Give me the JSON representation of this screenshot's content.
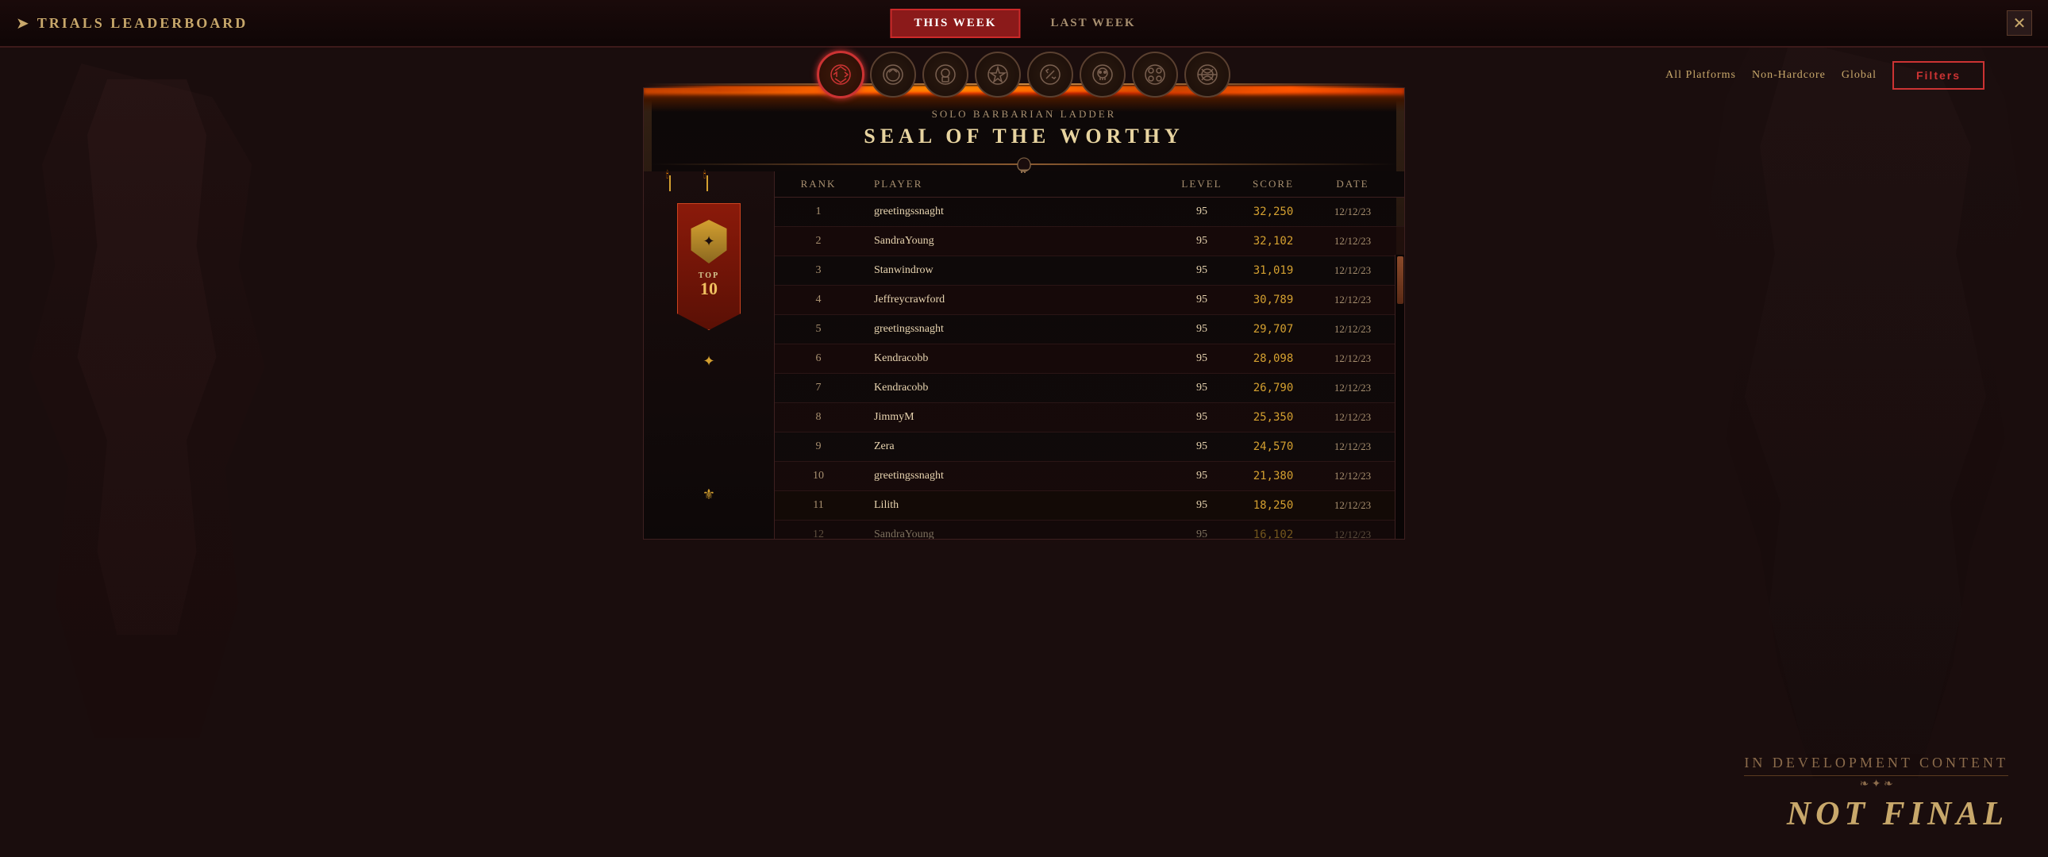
{
  "header": {
    "title": "TRIALS LEADERBOARD",
    "tabs": [
      {
        "label": "THIS WEEK",
        "active": true
      },
      {
        "label": "LAST WEEK",
        "active": false
      }
    ],
    "close_icon": "✕"
  },
  "class_icons": [
    {
      "name": "Barbarian",
      "symbol": "🔱",
      "active": true
    },
    {
      "name": "Druid",
      "symbol": "☽"
    },
    {
      "name": "Necromancer",
      "symbol": "💀"
    },
    {
      "name": "Sorcerer",
      "symbol": "⚡"
    },
    {
      "name": "Rogue",
      "symbol": "🗡"
    },
    {
      "name": "Skull",
      "symbol": "☠"
    },
    {
      "name": "Multi",
      "symbol": "❋"
    },
    {
      "name": "All",
      "symbol": "⊕"
    }
  ],
  "filter_controls": {
    "options": [
      "All Platforms",
      "Non-Hardcore",
      "Global"
    ],
    "filter_button": "Filters"
  },
  "ladder": {
    "subtitle": "SOLO BARBARIAN LADDER",
    "title": "SEAL OF THE WORTHY",
    "banner_top": "TOP",
    "banner_number": "10"
  },
  "table": {
    "columns": [
      {
        "label": "Rank"
      },
      {
        "label": "Player"
      },
      {
        "label": "Level"
      },
      {
        "label": "Score"
      },
      {
        "label": "Date"
      }
    ],
    "rows": [
      {
        "rank": "1",
        "player": "greetingssnaght",
        "level": "95",
        "score": "32,250",
        "date": "12/12/23"
      },
      {
        "rank": "2",
        "player": "SandraYoung",
        "level": "95",
        "score": "32,102",
        "date": "12/12/23"
      },
      {
        "rank": "3",
        "player": "Stanwindrow",
        "level": "95",
        "score": "31,019",
        "date": "12/12/23"
      },
      {
        "rank": "4",
        "player": "Jeffreycrawford",
        "level": "95",
        "score": "30,789",
        "date": "12/12/23"
      },
      {
        "rank": "5",
        "player": "greetingssnaght",
        "level": "95",
        "score": "29,707",
        "date": "12/12/23"
      },
      {
        "rank": "6",
        "player": "Kendracobb",
        "level": "95",
        "score": "28,098",
        "date": "12/12/23"
      },
      {
        "rank": "7",
        "player": "Kendracobb",
        "level": "95",
        "score": "26,790",
        "date": "12/12/23"
      },
      {
        "rank": "8",
        "player": "JimmyM",
        "level": "95",
        "score": "25,350",
        "date": "12/12/23"
      },
      {
        "rank": "9",
        "player": "Zera",
        "level": "95",
        "score": "24,570",
        "date": "12/12/23"
      },
      {
        "rank": "10",
        "player": "greetingssnaght",
        "level": "95",
        "score": "21,380",
        "date": "12/12/23"
      },
      {
        "rank": "11",
        "player": "Lilith",
        "level": "95",
        "score": "18,250",
        "date": "12/12/23"
      },
      {
        "rank": "12",
        "player": "SandraYoung",
        "level": "95",
        "score": "16,102",
        "date": "12/12/23"
      }
    ]
  },
  "watermark": {
    "in_dev": "IN DEVELOPMENT CONTENT",
    "not_final": "NOT FINAL"
  },
  "colors": {
    "accent_red": "#cc3333",
    "accent_gold": "#d4a030",
    "text_light": "#e8d4b0",
    "text_muted": "#a89070",
    "bg_dark": "#0d0808",
    "border_color": "#3d2020"
  }
}
